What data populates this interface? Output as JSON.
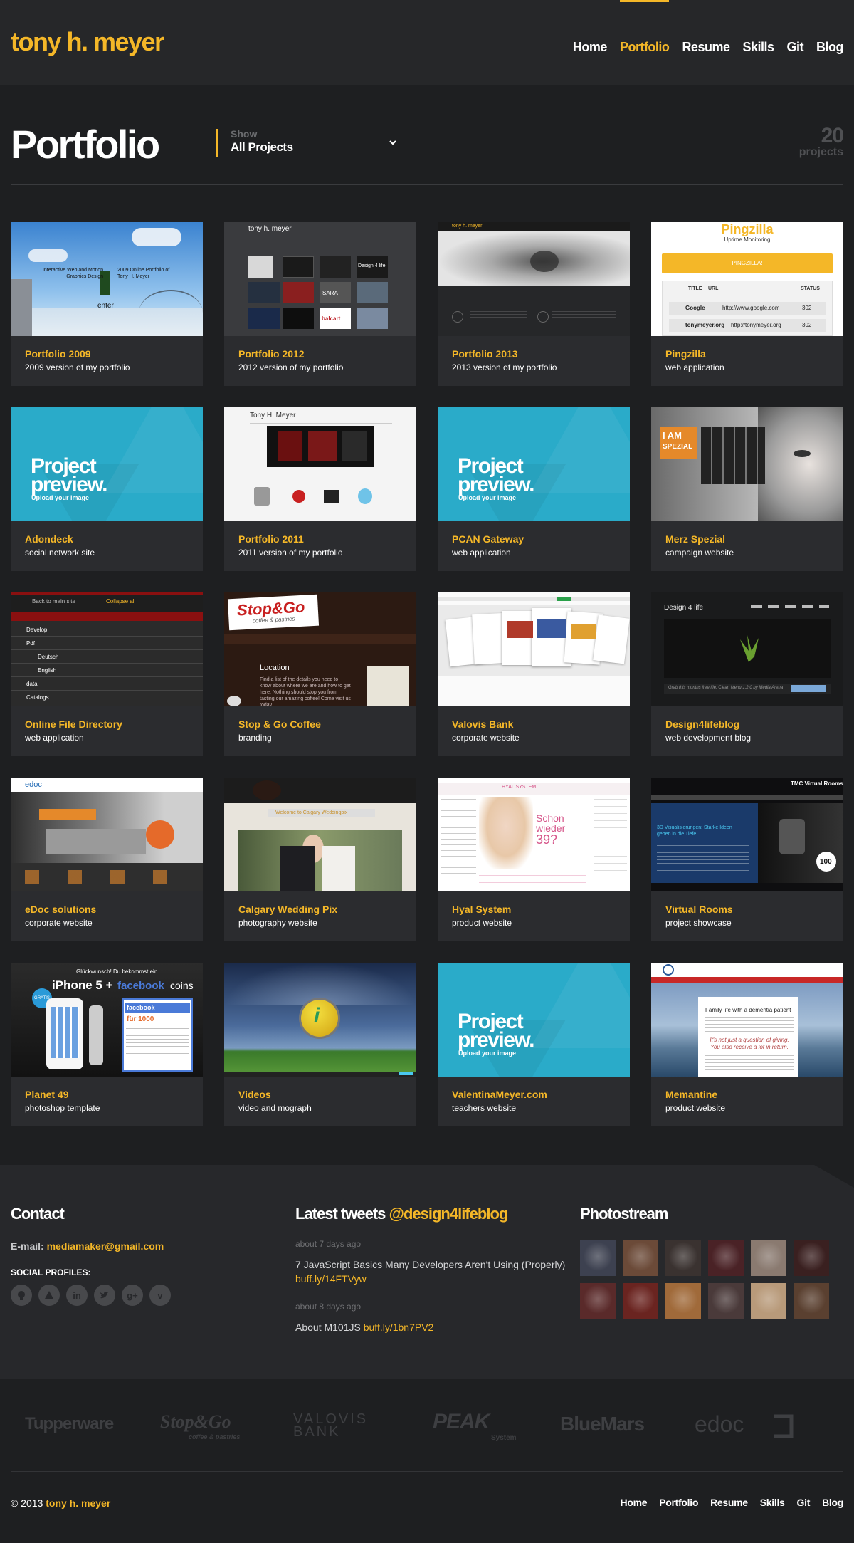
{
  "site": {
    "logo": "tony h. meyer"
  },
  "nav": [
    {
      "label": "Home",
      "active": false
    },
    {
      "label": "Portfolio",
      "active": true
    },
    {
      "label": "Resume",
      "active": false
    },
    {
      "label": "Skills",
      "active": false
    },
    {
      "label": "Git",
      "active": false
    },
    {
      "label": "Blog",
      "active": false
    }
  ],
  "page": {
    "title": "Portfolio",
    "filter_label": "Show",
    "filter_value": "All Projects",
    "count_number": "20",
    "count_unit": "projects"
  },
  "projects": [
    {
      "title": "Portfolio 2009",
      "subtitle": "2009 version of my portfolio",
      "thumb": "sky"
    },
    {
      "title": "Portfolio 2012",
      "subtitle": "2012 version of my portfolio",
      "thumb": "dark-grid"
    },
    {
      "title": "Portfolio 2013",
      "subtitle": "2013 version of my portfolio",
      "thumb": "cat"
    },
    {
      "title": "Pingzilla",
      "subtitle": "web application",
      "thumb": "pingzilla"
    },
    {
      "title": "Adondeck",
      "subtitle": "social network site",
      "thumb": "preview"
    },
    {
      "title": "Portfolio 2011",
      "subtitle": "2011 version of my portfolio",
      "thumb": "white-site"
    },
    {
      "title": "PCAN Gateway",
      "subtitle": "web application",
      "thumb": "preview"
    },
    {
      "title": "Merz Spezial",
      "subtitle": "campaign website",
      "thumb": "merz"
    },
    {
      "title": "Online File Directory",
      "subtitle": "web application",
      "thumb": "files"
    },
    {
      "title": "Stop & Go Coffee",
      "subtitle": "branding",
      "thumb": "stopgo"
    },
    {
      "title": "Valovis Bank",
      "subtitle": "corporate website",
      "thumb": "valovis"
    },
    {
      "title": "Design4lifeblog",
      "subtitle": "web development blog",
      "thumb": "d4l"
    },
    {
      "title": "eDoc solutions",
      "subtitle": "corporate website",
      "thumb": "edoc"
    },
    {
      "title": "Calgary Wedding Pix",
      "subtitle": "photography website",
      "thumb": "wedding"
    },
    {
      "title": "Hyal System",
      "subtitle": "product website",
      "thumb": "hyal"
    },
    {
      "title": "Virtual Rooms",
      "subtitle": "project showcase",
      "thumb": "vrooms"
    },
    {
      "title": "Planet 49",
      "subtitle": "photoshop template",
      "thumb": "planet49"
    },
    {
      "title": "Videos",
      "subtitle": "video and mograph",
      "thumb": "videos"
    },
    {
      "title": "ValentinaMeyer.com",
      "subtitle": "teachers website",
      "thumb": "preview"
    },
    {
      "title": "Memantine",
      "subtitle": "product website",
      "thumb": "memantine"
    }
  ],
  "preview": {
    "line1": "Project",
    "line2": "preview.",
    "upload": "Upload your image"
  },
  "thumb_text": {
    "p2009_a": "Interactive Web and Motion Graphics Design",
    "p2009_b": "2009 Online Portfolio of Tony H. Meyer",
    "p2009_enter": "enter",
    "p2012_name": "tony h. meyer",
    "p2012_badge": "Design 4 life",
    "p2012_sara": "SARA",
    "p2012_balcart": "balcart",
    "p2013_name": "tony h. meyer",
    "ping_title": "Pingzilla",
    "ping_sub": "Uptime Monitoring",
    "ping_btn": "PINGZILLA!",
    "ping_h1": "TITLE",
    "ping_h2": "URL",
    "ping_h3": "STATUS",
    "ping_r1a": "Google",
    "ping_r1b": "http://www.google.com",
    "ping_r1c": "302",
    "ping_r2a": "tonymeyer.org",
    "ping_r2b": "http://tonymeyer.org",
    "ping_r2c": "302",
    "p2011_name": "Tony H. Meyer",
    "merz_a": "I AM",
    "merz_b": "SPEZIAL",
    "files_back": "Back to main site",
    "files_collapse": "Collapse all",
    "files_items": [
      "Develop",
      "Pdf",
      "Deutsch",
      "English",
      "data",
      "Catalogs"
    ],
    "stop_logo": "Stop&Go",
    "stop_sub": "coffee & pastries",
    "stop_loc": "Location",
    "stop_body": "Find a list of the details you need to know about where we are and how to get here. Nothing should stop you from tasting our amazing coffee! Come visit us today",
    "d4l_logo": "Design 4 life",
    "d4l_caption": "Grab this months free file, Clean Menu 1.2.0 by Media Arena",
    "edoc_logo": "edoc",
    "wed_banner": "Welcome to Calgary Weddingpix",
    "hyal_nav": "HYAL SYSTEM",
    "hyal_big1": "Schon",
    "hyal_big2": "wieder",
    "hyal_big3": "39?",
    "vr_title": "TMC Virtual Rooms",
    "vr_sub": "3D Visualisierungen: Starke Ideen gehen in die Tiefe",
    "vr_badge": "100",
    "p49_top": "Glückwunsch! Du bekommst ein...",
    "p49_iphone": "iPhone 5 +",
    "p49_fb": "facebook",
    "p49_coins": "coins",
    "p49_amount": "für 1000",
    "p49_gratis": "GRATIS",
    "mem_title": "Family life with a dementia patient",
    "mem_quote": "It's not just a question of giving. You also receive a lot in return."
  },
  "footer": {
    "contact_heading": "Contact",
    "email_label": "E-mail:",
    "email": "mediamaker@gmail.com",
    "social_label": "SOCIAL PROFILES:",
    "tweets_heading": "Latest tweets",
    "tweets_handle": "@design4lifeblog",
    "tweets": [
      {
        "date": "about 7 days ago",
        "text": "7 JavaScript Basics Many Developers Aren't Using (Properly)",
        "link": "buff.ly/14FTVyw"
      },
      {
        "date": "about 8 days ago",
        "text": "About M101JS",
        "link": "buff.ly/1bn7PV2"
      }
    ],
    "photo_heading": "Photostream",
    "photo_colors": [
      "#3d4150",
      "#6b4a38",
      "#3a3230",
      "#4a2226",
      "#8a7a70",
      "#3a2020",
      "#5a2a2a",
      "#6a2420",
      "#a06a3a",
      "#4a3a3a",
      "#b89a7a",
      "#5a4030"
    ]
  },
  "clients": [
    "Tupperware",
    "Stop&Go",
    "VALOVIS BANK",
    "PEAK",
    "BlueMars",
    "edoc"
  ],
  "clients_sub": {
    "stopgo": "coffee & pastries",
    "peak": "System"
  },
  "bottom": {
    "copyright": "© 2013",
    "owner": "tony h. meyer",
    "nav": [
      "Home",
      "Portfolio",
      "Resume",
      "Skills",
      "Git",
      "Blog"
    ]
  },
  "colors": {
    "accent": "#f4b728",
    "bg": "#1e1f21",
    "card": "#2b2c2f",
    "preview": "#2aabc9"
  }
}
